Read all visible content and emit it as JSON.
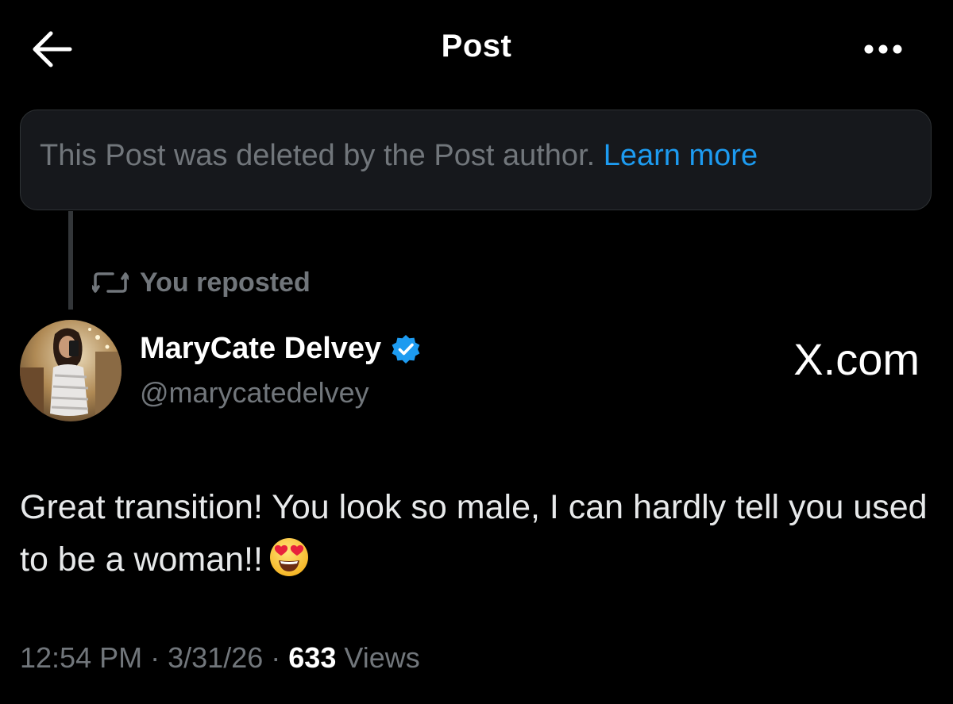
{
  "header": {
    "title": "Post",
    "back_icon": "arrow-left-icon",
    "more_icon": "more-horizontal-icon"
  },
  "deleted_notice": {
    "text": "This Post was deleted by the Post author.",
    "link_text": "Learn more"
  },
  "repost": {
    "icon": "repost-icon",
    "label": "You reposted"
  },
  "post": {
    "author_name": "MaryCate Delvey",
    "author_handle": "@marycatedelvey",
    "verified_icon": "verified-badge-icon",
    "body_text": "Great transition! You look so male, I can hardly tell you used to be a woman!!",
    "emoji": "heart-eyes-emoji-icon"
  },
  "meta": {
    "time": "12:54 PM",
    "separator": "·",
    "date": "3/31/26",
    "views_count": "633",
    "views_label": "Views"
  },
  "watermark": {
    "text": "X.com"
  },
  "colors": {
    "background": "#000000",
    "primary_text": "#e7e9ea",
    "secondary_text": "#71767b",
    "accent": "#1d9bf0",
    "card_background": "#16181c",
    "border": "#2f3336"
  }
}
